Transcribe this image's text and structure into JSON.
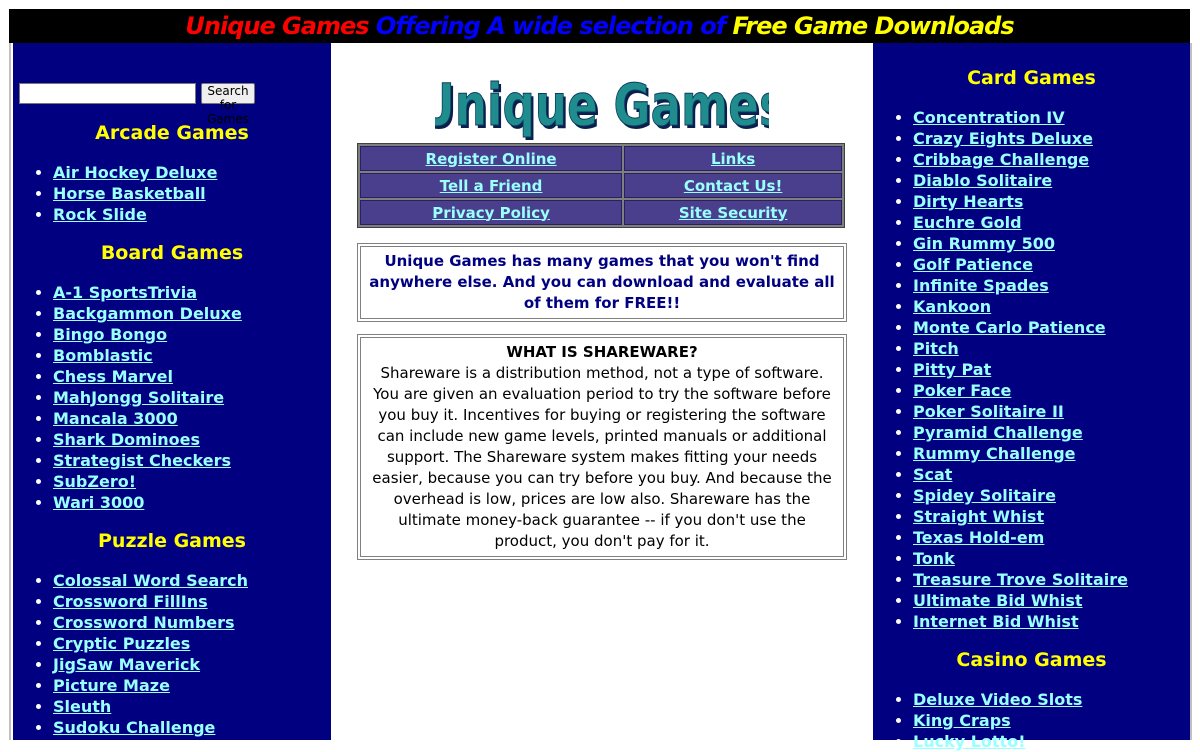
{
  "banner": {
    "part1": "Unique Games",
    "part2": " Offering A wide selection of ",
    "part3": "Free Game Downloads"
  },
  "colors": {
    "navy": "#000080",
    "heading_yellow": "#ffff00",
    "link_cyan": "#99ffff",
    "banner_red": "#ff0000",
    "banner_blue": "#0000ff",
    "banner_yellow": "#ffff00",
    "nav_cell": "#4a3f8c"
  },
  "search": {
    "value": "",
    "button_label": "Search for Games"
  },
  "left": {
    "arcade": {
      "title": "Arcade Games",
      "items": [
        "Air Hockey Deluxe",
        "Horse Basketball",
        "Rock Slide"
      ]
    },
    "board": {
      "title": "Board Games",
      "items": [
        "A-1 SportsTrivia",
        "Backgammon Deluxe",
        "Bingo Bongo",
        "Bomblastic",
        "Chess Marvel",
        "MahJongg Solitaire",
        "Mancala 3000",
        "Shark Dominoes",
        "Strategist Checkers",
        "SubZero!",
        "Wari 3000"
      ]
    },
    "puzzle": {
      "title": "Puzzle Games",
      "items": [
        "Colossal Word Search",
        "Crossword FillIns",
        "Crossword Numbers",
        "Cryptic Puzzles",
        "JigSaw Maverick",
        "Picture Maze",
        "Sleuth",
        "Sudoku Challenge"
      ]
    }
  },
  "logo": {
    "text": "Unique Games"
  },
  "nav": {
    "register": "Register Online",
    "links": "Links",
    "tell": "Tell a Friend",
    "contact": "Contact Us!",
    "privacy": "Privacy Policy",
    "security": "Site Security"
  },
  "intro": "Unique Games has many games that you won't find anywhere else. And you can download and evaluate all of them for FREE!!",
  "shareware": {
    "title": "WHAT IS SHAREWARE?",
    "body": "Shareware is a distribution method, not a type of software. You are given an evaluation period to try the software before you buy it. Incentives for buying or registering the software can include new game levels, printed manuals or additional support. The Shareware system makes fitting your needs easier, because you can try before you buy. And because the overhead is low, prices are low also. Shareware has the ultimate money-back guarantee -- if you don't use the product, you don't pay for it."
  },
  "right": {
    "card": {
      "title": "Card Games",
      "items": [
        "Concentration IV",
        "Crazy Eights Deluxe",
        "Cribbage Challenge",
        "Diablo Solitaire",
        "Dirty Hearts",
        "Euchre Gold",
        "Gin Rummy 500",
        "Golf Patience",
        "Infinite Spades",
        "Kankoon",
        "Monte Carlo Patience",
        "Pitch",
        "Pitty Pat",
        "Poker Face",
        "Poker Solitaire II",
        "Pyramid Challenge",
        "Rummy Challenge",
        "Scat",
        "Spidey Solitaire",
        "Straight Whist",
        "Texas Hold-em",
        "Tonk",
        "Treasure Trove Solitaire",
        "Ultimate Bid Whist",
        "Internet Bid Whist"
      ]
    },
    "casino": {
      "title": "Casino Games",
      "items": [
        "Deluxe Video Slots",
        "King Craps",
        "Lucky Lotto!"
      ]
    }
  }
}
